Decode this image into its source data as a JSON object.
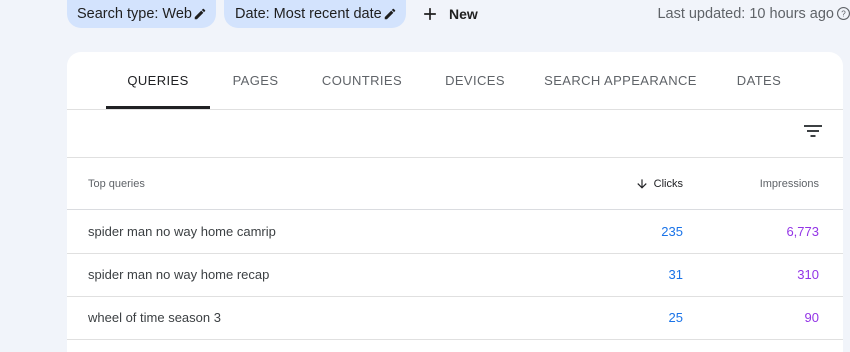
{
  "filters": {
    "search_type": "Search type: Web",
    "date": "Date: Most recent date",
    "new_label": "New"
  },
  "last_updated": "Last updated: 10 hours ago",
  "tabs": [
    {
      "label": "QUERIES",
      "active": true
    },
    {
      "label": "PAGES"
    },
    {
      "label": "COUNTRIES"
    },
    {
      "label": "DEVICES"
    },
    {
      "label": "SEARCH APPEARANCE"
    },
    {
      "label": "DATES"
    }
  ],
  "table": {
    "headers": {
      "query": "Top queries",
      "clicks": "Clicks",
      "impressions": "Impressions"
    },
    "sort": "clicks-descending",
    "rows": [
      {
        "query": "spider man no way home camrip",
        "clicks": "235",
        "impressions": "6,773"
      },
      {
        "query": "spider man no way home recap",
        "clicks": "31",
        "impressions": "310"
      },
      {
        "query": "wheel of time season 3",
        "clicks": "25",
        "impressions": "90"
      }
    ]
  },
  "colors": {
    "chip_bg": "#d3e3fd",
    "clicks": "#1a73e8",
    "impressions": "#9334e6",
    "page_bg": "#f1f4fa"
  },
  "icons": [
    "pencil-icon",
    "plus-icon",
    "help-icon",
    "filter-icon",
    "arrow-down-icon"
  ]
}
